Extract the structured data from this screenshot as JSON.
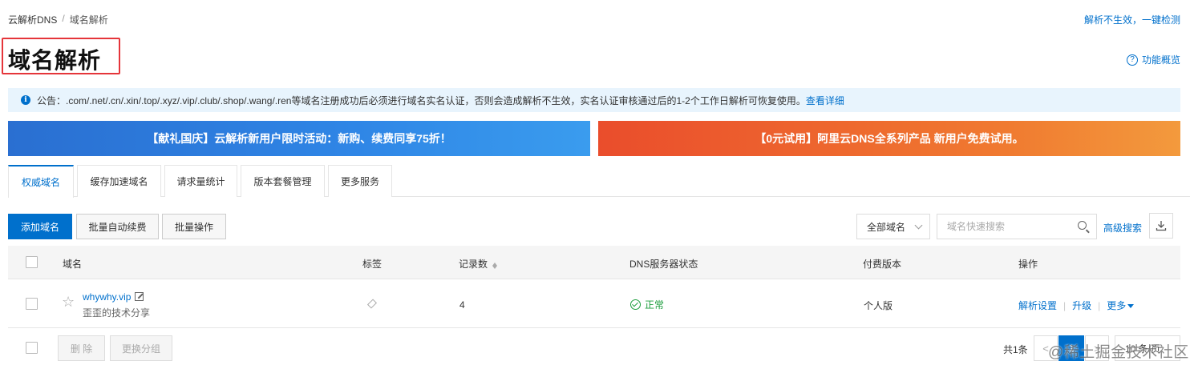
{
  "breadcrumb": {
    "root": "云解析DNS",
    "separator": "/",
    "current": "域名解析"
  },
  "header": {
    "title": "域名解析",
    "top_right_link": "解析不生效，一键检测",
    "overview_label": "功能概览",
    "overview_icon": "?"
  },
  "notice": {
    "icon": "i",
    "text": "公告：.com/.net/.cn/.xin/.top/.xyz/.vip/.club/.shop/.wang/.ren等域名注册成功后必须进行域名实名认证，否则会造成解析不生效，实名认证审核通过后的1-2个工作日解析可恢复使用。",
    "link": "查看详细"
  },
  "banners": {
    "left": "【献礼国庆】云解析新用户限时活动：新购、续费同享75折！",
    "right": "【0元试用】阿里云DNS全系列产品 新用户免费试用。"
  },
  "tabs": [
    {
      "label": "权威域名"
    },
    {
      "label": "缓存加速域名"
    },
    {
      "label": "请求量统计"
    },
    {
      "label": "版本套餐管理"
    },
    {
      "label": "更多服务"
    }
  ],
  "toolbar": {
    "add_domain": "添加域名",
    "batch_renew": "批量自动续费",
    "batch_ops": "批量操作",
    "domain_filter": "全部域名",
    "search_placeholder": "域名快速搜索",
    "advanced_search": "高级搜索"
  },
  "table": {
    "columns": {
      "domain": "域名",
      "tag": "标签",
      "records": "记录数",
      "dns_status": "DNS服务器状态",
      "edition": "付费版本",
      "actions": "操作"
    },
    "rows": [
      {
        "domain": "whywhy.vip",
        "remark": "歪歪的技术分享",
        "records": "4",
        "dns_status": "正常",
        "edition": "个人版",
        "actions": {
          "settings": "解析设置",
          "upgrade": "升级",
          "more": "更多"
        }
      }
    ]
  },
  "footer": {
    "delete": "删 除",
    "change_group": "更换分组",
    "total": "共1条",
    "current_page": "1",
    "page_size": "10 条/页",
    "prev": "<",
    "next": ">"
  },
  "watermark": "@稀土掘金技术社区",
  "colors": {
    "accent": "#0070cc",
    "ok": "#1e9e3e",
    "highlight_box": "#e5353a"
  }
}
